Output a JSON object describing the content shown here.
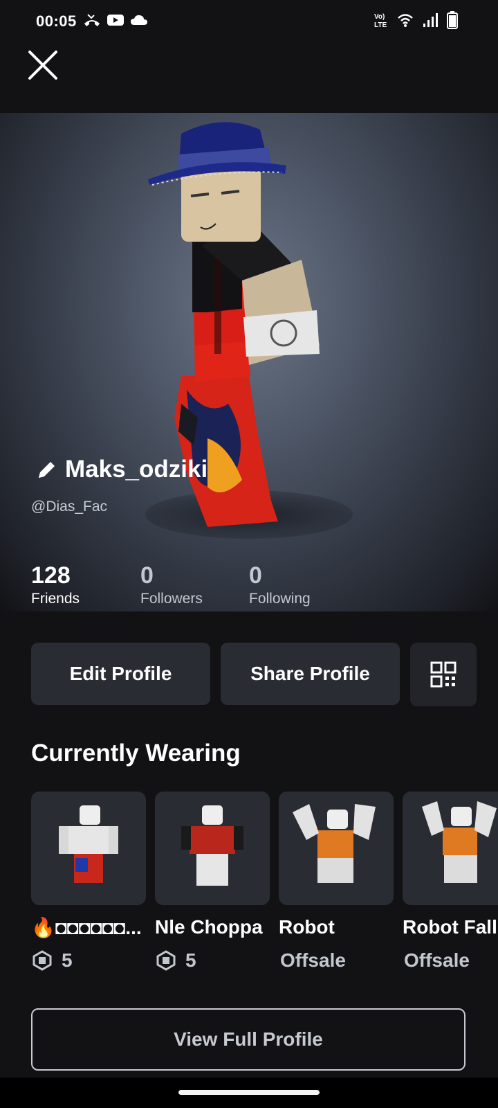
{
  "status_bar": {
    "time": "00:05",
    "left_icons": [
      "missed-call-icon",
      "youtube-icon",
      "cloud-icon"
    ],
    "volte": "Vo)\nLTE",
    "right_icons": [
      "volte-icon",
      "wifi-icon",
      "signal-icon",
      "battery-icon"
    ]
  },
  "header": {
    "close_icon": "close-icon"
  },
  "profile": {
    "display_name": "Maks_odziki",
    "username": "@Dias_Fac",
    "edit_icon": "pencil-icon"
  },
  "stats": [
    {
      "value": "128",
      "label": "Friends"
    },
    {
      "value": "0",
      "label": "Followers"
    },
    {
      "value": "0",
      "label": "Following"
    }
  ],
  "actions": {
    "edit_profile": "Edit Profile",
    "share_profile": "Share Profile",
    "qr_icon": "qr-code-icon"
  },
  "currently_wearing": {
    "title": "Currently Wearing",
    "items": [
      {
        "name": "🔥◘◘◘◘◘◘...",
        "price": "5",
        "currency_icon": "robux-icon"
      },
      {
        "name": "Nle Choppa",
        "price": "5",
        "currency_icon": "robux-icon"
      },
      {
        "name": "Robot",
        "price": "Offsale"
      },
      {
        "name": "Robot Fall",
        "price": "Offsale"
      }
    ]
  },
  "view_full_profile": "View Full Profile",
  "colors": {
    "background": "#121215",
    "button": "#2a2c33",
    "accent_text": "#c3c7ce"
  }
}
